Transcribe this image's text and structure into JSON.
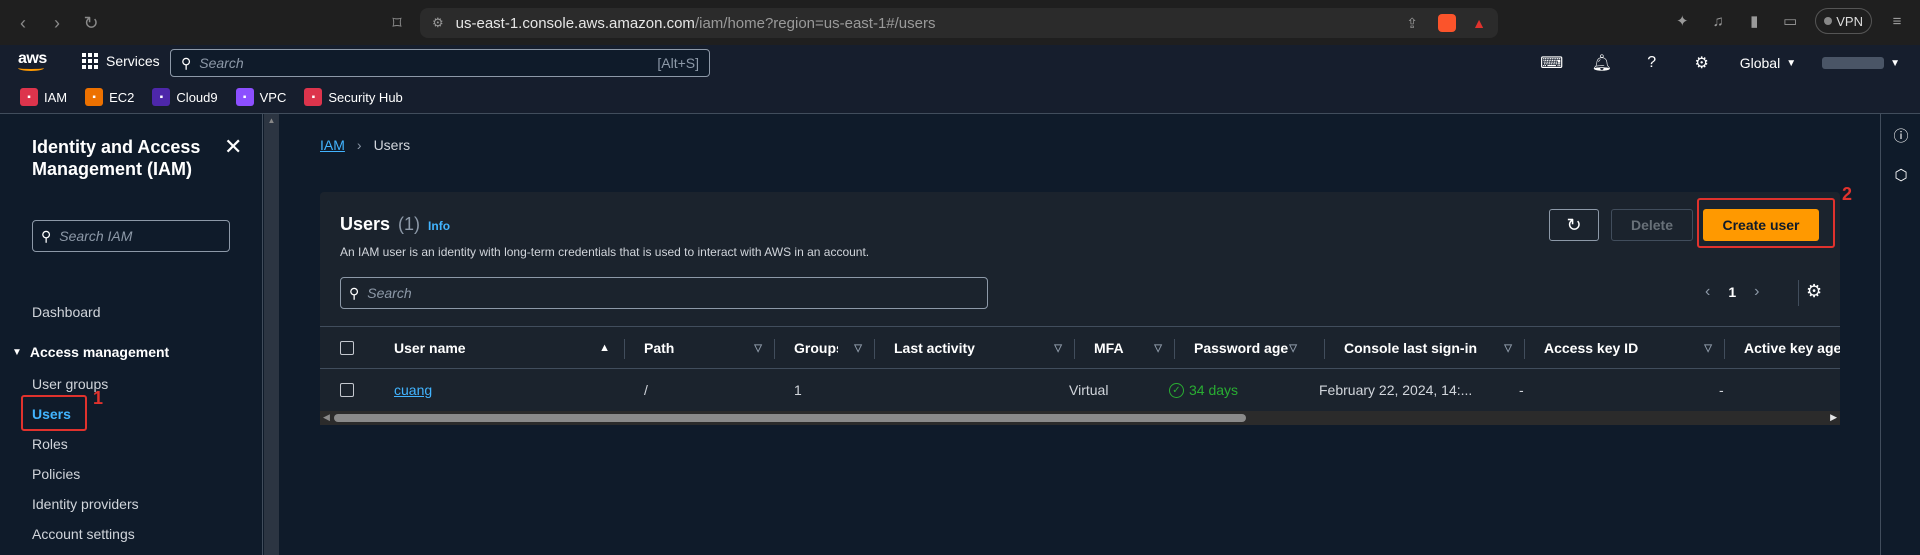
{
  "browser": {
    "url_host": "us-east-1.console.aws.amazon.com",
    "url_path": "/iam/home?region=us-east-1#/users",
    "vpn_label": "VPN"
  },
  "aws_nav": {
    "logo": "aws",
    "services_label": "Services",
    "search_placeholder": "Search",
    "search_shortcut": "[Alt+S]",
    "region_label": "Global"
  },
  "favorites": [
    {
      "label": "IAM",
      "color": "#dd344c"
    },
    {
      "label": "EC2",
      "color": "#ed7100"
    },
    {
      "label": "Cloud9",
      "color": "#4d27aa"
    },
    {
      "label": "VPC",
      "color": "#8c4fff"
    },
    {
      "label": "Security Hub",
      "color": "#dd344c"
    }
  ],
  "sidebar": {
    "title": "Identity and Access Management (IAM)",
    "search_placeholder": "Search IAM",
    "dashboard": "Dashboard",
    "section": "Access management",
    "items": [
      "User groups",
      "Users",
      "Roles",
      "Policies",
      "Identity providers",
      "Account settings"
    ]
  },
  "annotations": {
    "one": "1",
    "two": "2"
  },
  "breadcrumb": {
    "root": "IAM",
    "current": "Users"
  },
  "panel": {
    "title": "Users",
    "count": "(1)",
    "info": "Info",
    "description": "An IAM user is an identity with long-term credentials that is used to interact with AWS in an account.",
    "delete_label": "Delete",
    "create_label": "Create user",
    "search_placeholder": "Search",
    "page": "1"
  },
  "table": {
    "columns": [
      "User name",
      "Path",
      "Groups",
      "Last activity",
      "MFA",
      "Password age",
      "Console last sign-in",
      "Access key ID",
      "Active key age"
    ],
    "row": {
      "user_name": "cuang",
      "path": "/",
      "groups": "1",
      "last_activity": "",
      "mfa": "Virtual",
      "password_age": "34 days",
      "console_last_signin": "February 22, 2024, 14:...",
      "access_key_id": "-",
      "active_key_age": "-"
    }
  },
  "colors": {
    "accent": "#ff9900",
    "link": "#42b4ff",
    "success": "#29ad32",
    "annotation": "#e0322d"
  }
}
